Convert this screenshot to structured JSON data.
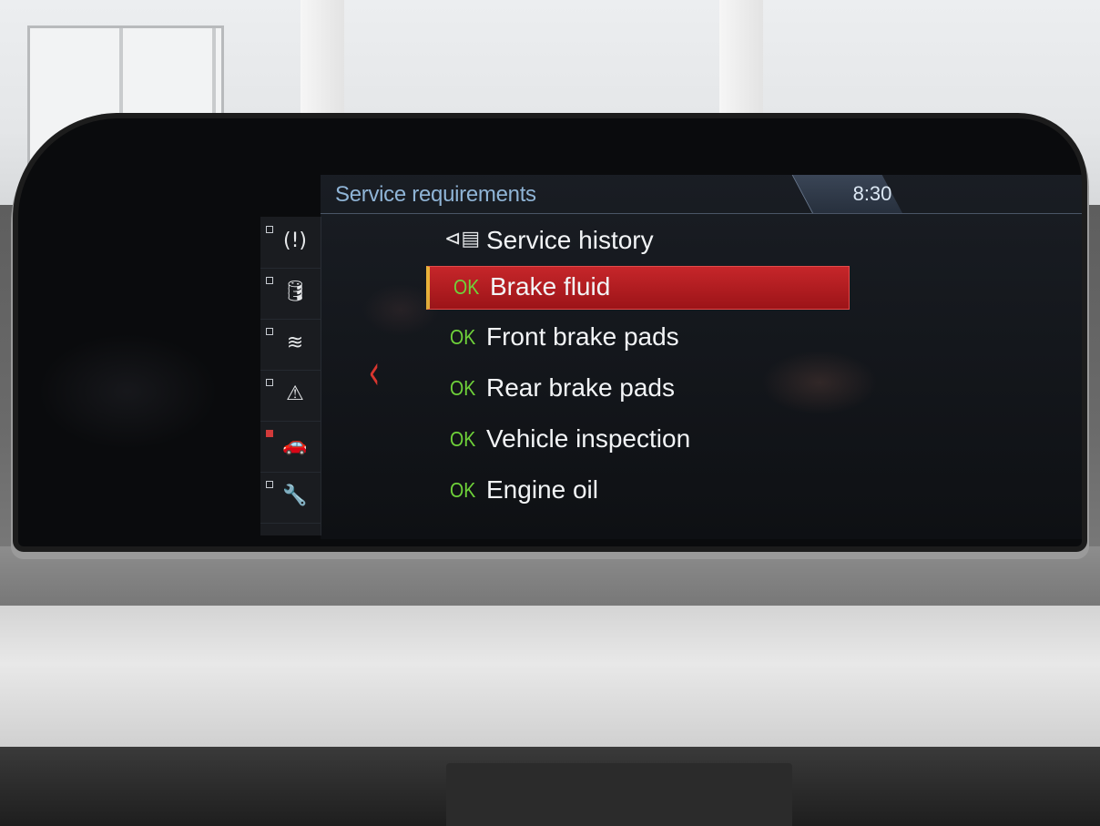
{
  "header": {
    "title": "Service requirements",
    "clock": "8:30"
  },
  "side_icons": [
    {
      "name": "tire-pressure-icon",
      "glyph": "(!)",
      "active": false
    },
    {
      "name": "oil-level-icon",
      "glyph": "🛢",
      "active": false
    },
    {
      "name": "engine-coolant-icon",
      "glyph": "≋",
      "active": false
    },
    {
      "name": "warning-triangle-icon",
      "glyph": "⚠",
      "active": false
    },
    {
      "name": "vehicle-status-icon",
      "glyph": "🚗",
      "active": true
    },
    {
      "name": "teleservice-icon",
      "glyph": "🔧",
      "active": false
    }
  ],
  "menu": {
    "service_history": {
      "icon": "service-history-icon",
      "label": "Service history"
    },
    "items": [
      {
        "status": "OK",
        "label": "Brake fluid",
        "selected": true
      },
      {
        "status": "OK",
        "label": "Front brake pads",
        "selected": false
      },
      {
        "status": "OK",
        "label": "Rear brake pads",
        "selected": false
      },
      {
        "status": "OK",
        "label": "Vehicle inspection",
        "selected": false
      },
      {
        "status": "OK",
        "label": "Engine oil",
        "selected": false
      }
    ]
  },
  "colors": {
    "accent_red": "#c6262a",
    "ok_green": "#6fd23a",
    "title_blue": "#8fb4d6"
  }
}
